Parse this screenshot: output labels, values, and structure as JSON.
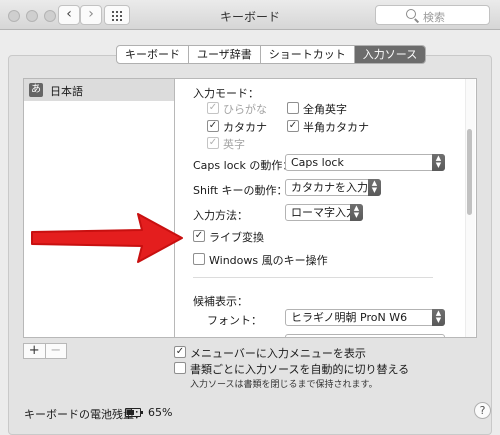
{
  "window": {
    "title": "キーボード",
    "search_placeholder": "検索"
  },
  "tabs": [
    "キーボード",
    "ユーザ辞書",
    "ショートカット",
    "入力ソース"
  ],
  "sources": [
    {
      "badge": "あ",
      "label": "日本語"
    }
  ],
  "options": {
    "input_mode_label": "入力モード：",
    "modes": {
      "hiragana": "ひらがな",
      "zenkaku_eisu": "全角英字",
      "katakana": "カタカナ",
      "hankaku_katakana": "半角カタカナ",
      "eiji": "英字"
    },
    "caps_lock_label": "Caps lock の動作：",
    "caps_lock_value": "Caps lock",
    "shift_label": "Shift キーの動作：",
    "shift_value": "カタカナを入力",
    "input_method_label": "入力方法：",
    "input_method_value": "ローマ字入力",
    "live_conversion": "ライブ変換",
    "windows_keys": "Windows 風のキー操作",
    "candidates_label": "候補表示：",
    "font_label": "フォント：",
    "font_value": "ヒラギノ明朝 ProN W6"
  },
  "bottom": {
    "show_menu": "メニューバーに入力メニューを表示",
    "auto_switch": "書類ごとに入力ソースを自動的に切り替える",
    "note": "入力ソースは書類を閉じるまで保持されます。"
  },
  "battery": {
    "label": "キーボードの電池残量：",
    "percent": "65%"
  },
  "colors": {
    "arrow": "#e41e1e",
    "selected_tab": "#6c6c6c"
  }
}
